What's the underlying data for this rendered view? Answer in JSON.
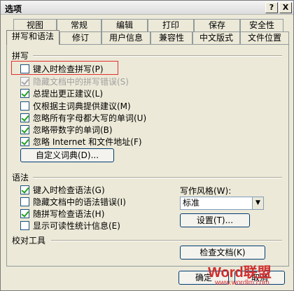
{
  "title": "选项",
  "titlebar": {
    "help": "?",
    "close": "X"
  },
  "tabs_row1": [
    "视图",
    "常规",
    "编辑",
    "打印",
    "保存",
    "安全性"
  ],
  "tabs_row2": [
    "拼写和语法",
    "修订",
    "用户信息",
    "兼容性",
    "中文版式",
    "文件位置"
  ],
  "spelling": {
    "label": "拼写",
    "options": [
      {
        "label": "键入时检查拼写(P)",
        "checked": false,
        "disabled": false
      },
      {
        "label": "隐藏文档中的拼写错误(S)",
        "checked": true,
        "disabled": true
      },
      {
        "label": "总提出更正建议(L)",
        "checked": true,
        "disabled": false
      },
      {
        "label": "仅根据主词典提供建议(M)",
        "checked": false,
        "disabled": false
      },
      {
        "label": "忽略所有字母都大写的单词(U)",
        "checked": true,
        "disabled": false
      },
      {
        "label": "忽略带数字的单词(B)",
        "checked": true,
        "disabled": false
      },
      {
        "label": "忽略 Internet 和文件地址(F)",
        "checked": true,
        "disabled": false
      }
    ],
    "dict_button": "自定义词典(D)..."
  },
  "grammar": {
    "label": "语法",
    "options": [
      {
        "label": "键入时检查语法(G)",
        "checked": true
      },
      {
        "label": "隐藏文档中的语法错误(I)",
        "checked": false
      },
      {
        "label": "随拼写检查语法(H)",
        "checked": true
      },
      {
        "label": "显示可读性统计信息(E)",
        "checked": false
      }
    ],
    "style_label": "写作风格(W):",
    "style_value": "标准",
    "settings_button": "设置(T)..."
  },
  "proofing": {
    "label": "校对工具",
    "check_button": "检查文档(K)"
  },
  "footer": {
    "ok": "确定",
    "cancel": "取消"
  },
  "watermark": {
    "main": "Word联盟",
    "sub": "www.wordlm.com"
  }
}
